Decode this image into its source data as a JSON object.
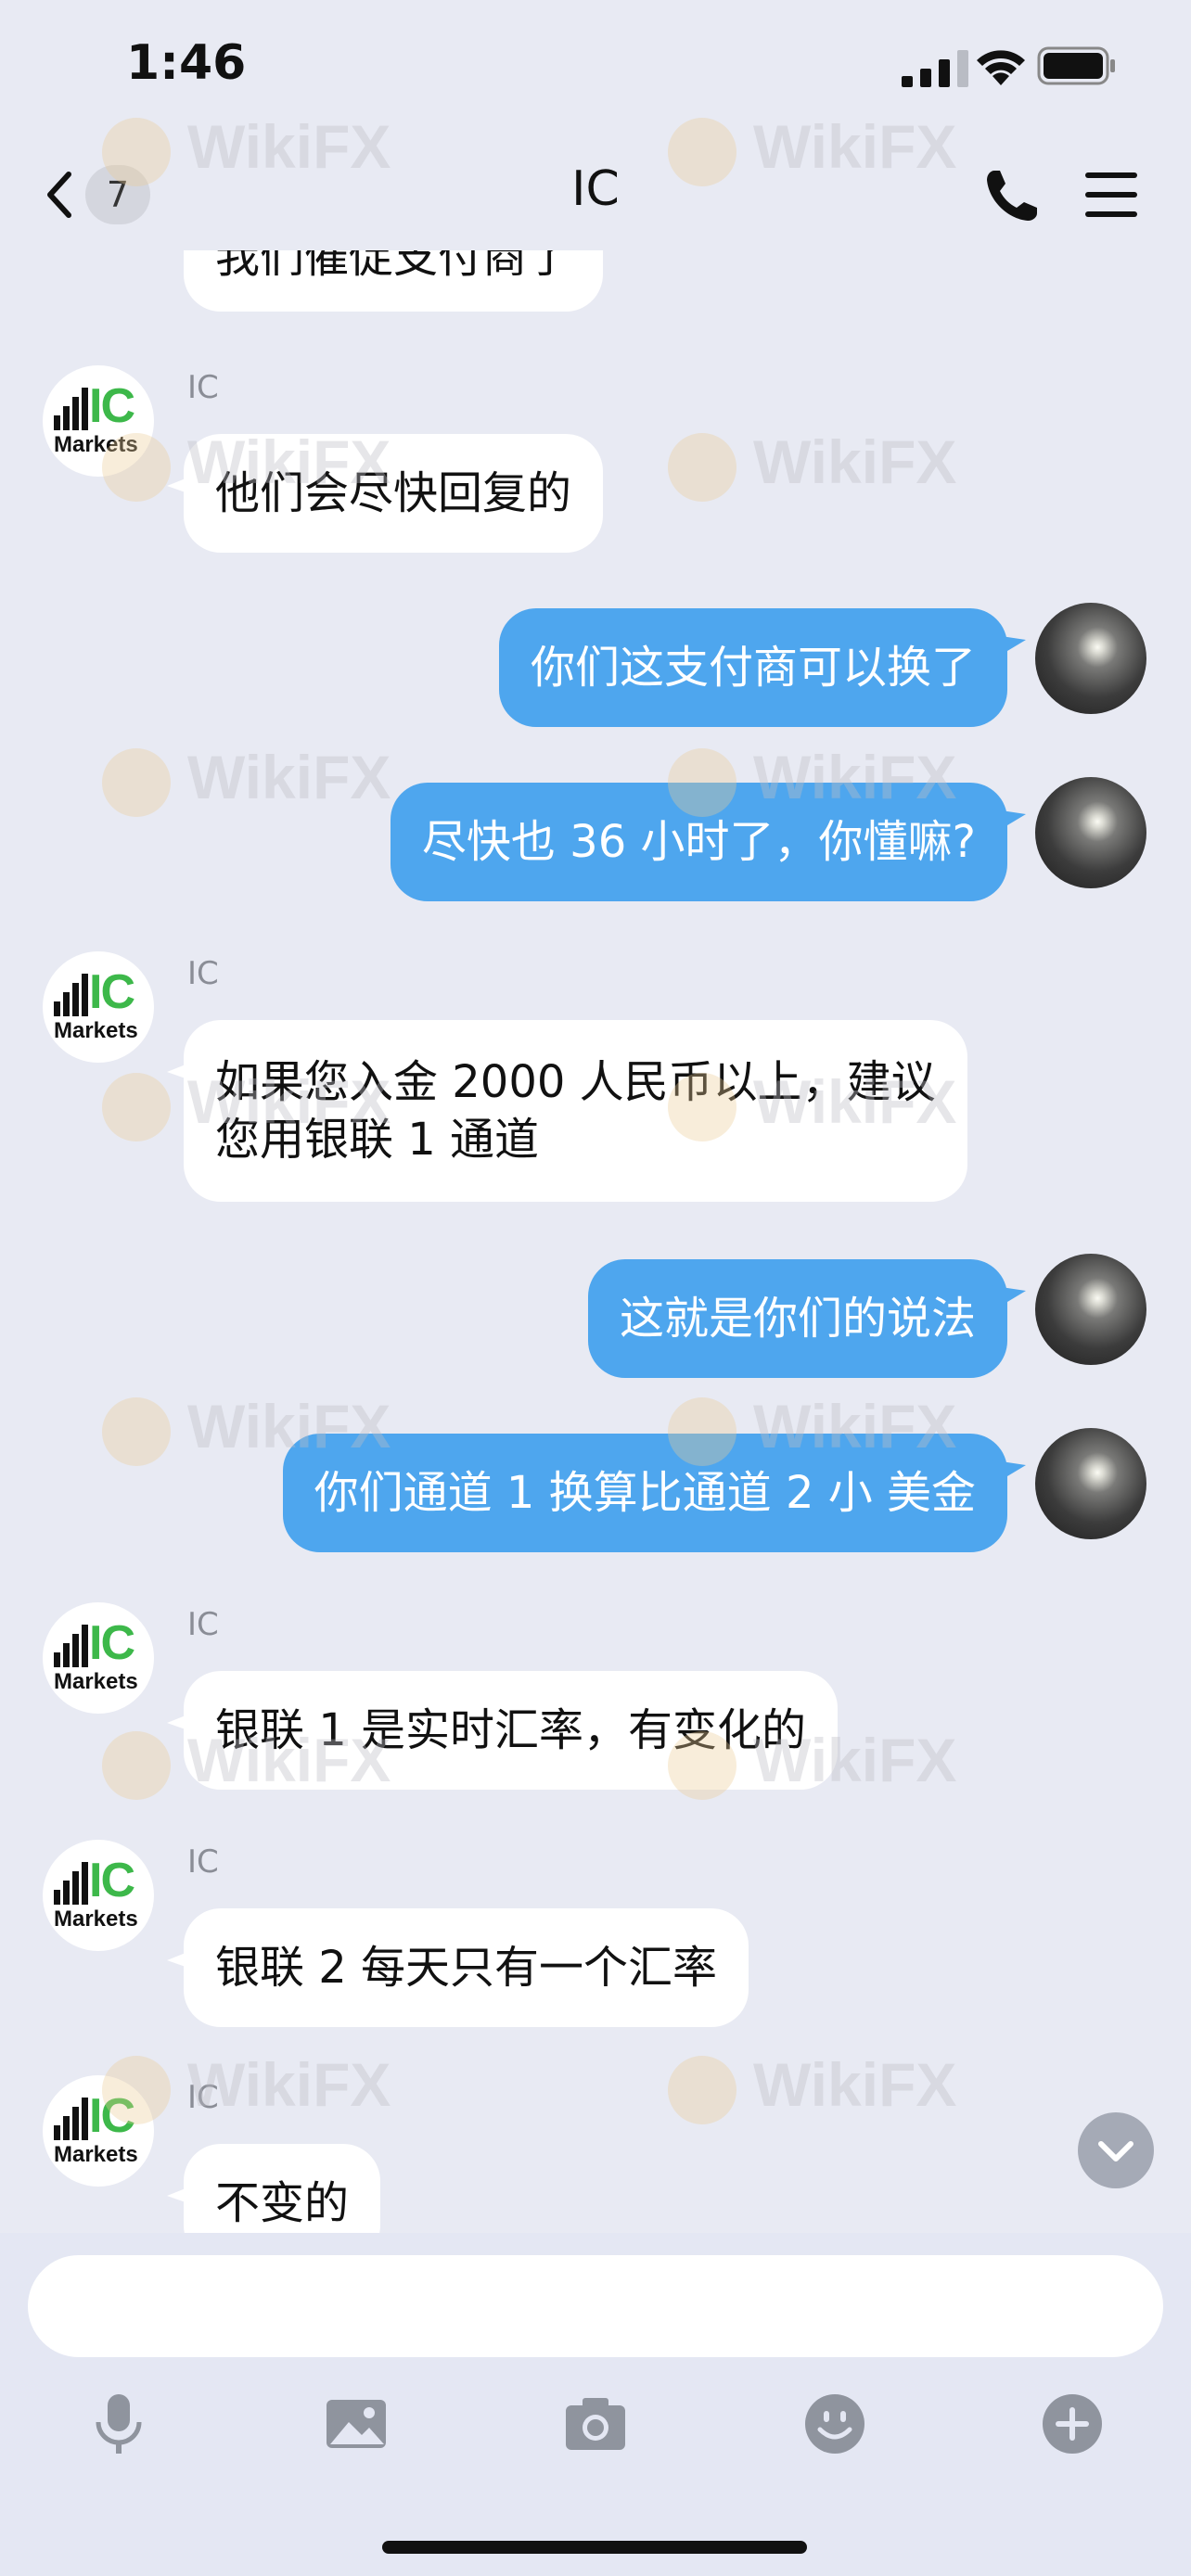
{
  "status_bar": {
    "time": "1:46"
  },
  "header": {
    "back_count": "7",
    "title": "IC"
  },
  "avatar": {
    "left_logo_text": "IC",
    "left_logo_sub": "Markets"
  },
  "messages": [
    {
      "side": "left",
      "sender": "",
      "text": "我们催促支付商了"
    },
    {
      "side": "left",
      "sender": "IC",
      "text": "他们会尽快回复的"
    },
    {
      "side": "right",
      "text": "你们这支付商可以换了"
    },
    {
      "side": "right",
      "text": "尽快也 36 小时了，你懂嘛?"
    },
    {
      "side": "left",
      "sender": "IC",
      "text_line1": "如果您入金 2000 人民币以上，建议",
      "text_line2": "您用银联 1 通道"
    },
    {
      "side": "right",
      "text": "这就是你们的说法"
    },
    {
      "side": "right",
      "text": "你们通道 1 换算比通道 2 小 美金"
    },
    {
      "side": "left",
      "sender": "IC",
      "text": "银联 1 是实时汇率，有变化的"
    },
    {
      "side": "left",
      "sender": "IC",
      "text": "银联 2 每天只有一个汇率"
    },
    {
      "side": "left",
      "sender": "IC",
      "text": "不变的"
    }
  ],
  "watermark": {
    "text": "WikiFX"
  },
  "colors": {
    "background": "#e8eaf3",
    "bubble_right": "#4ea6ee",
    "bubble_left": "#ffffff",
    "logo_green": "#3db84a"
  },
  "icons": [
    "back-icon",
    "phone-icon",
    "menu-icon",
    "chevron-down-icon",
    "microphone-icon",
    "image-icon",
    "camera-icon",
    "emoji-icon",
    "plus-icon"
  ]
}
